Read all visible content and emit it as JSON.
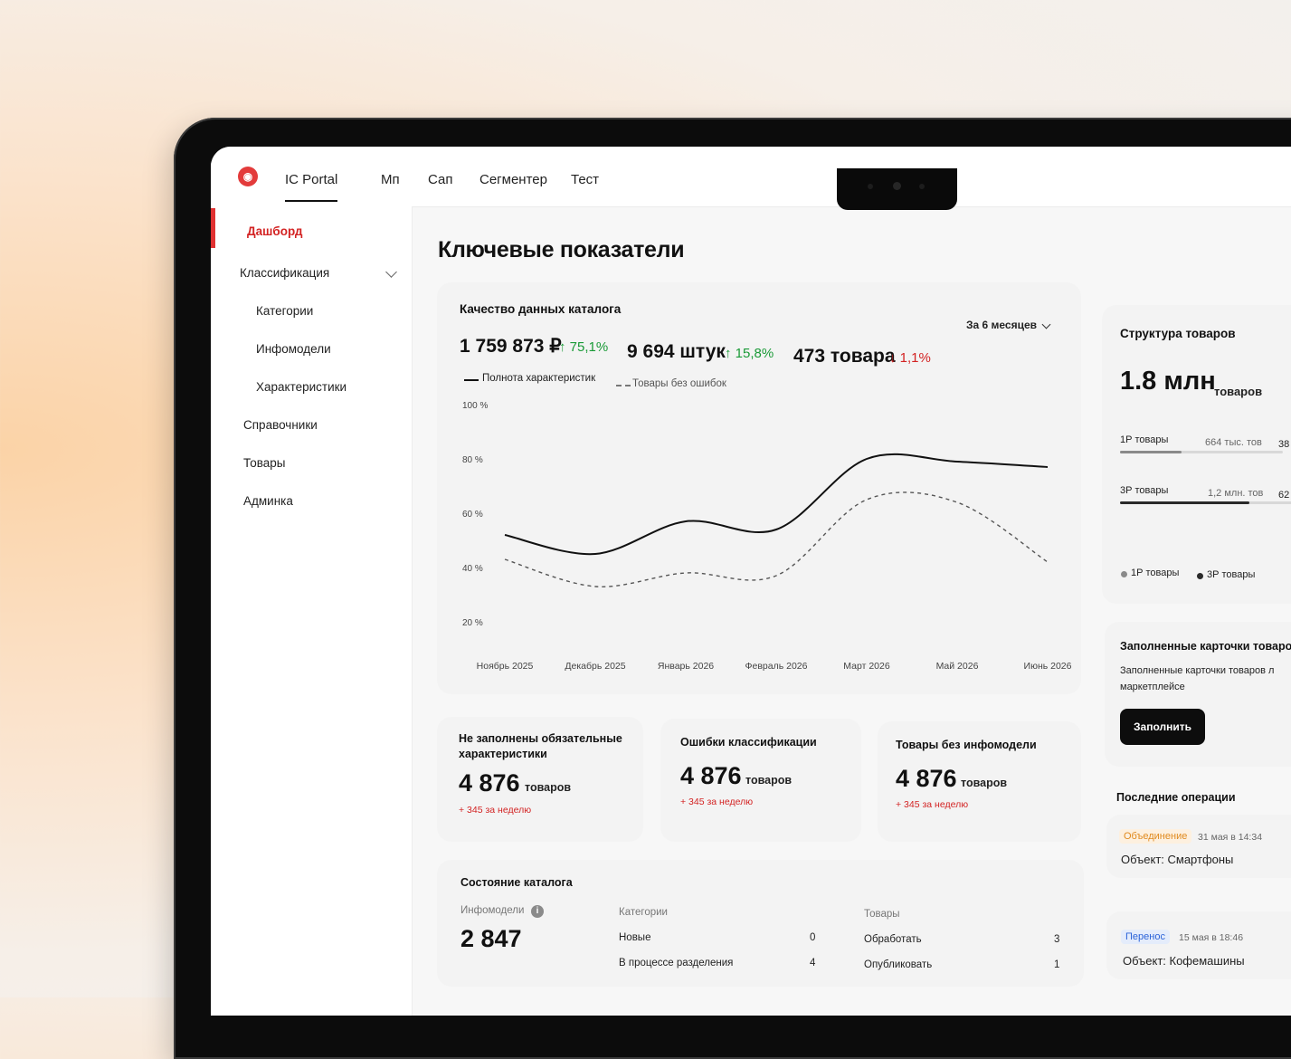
{
  "nav": {
    "tabs": [
      "IC Portal",
      "Мп",
      "Сап",
      "Сегментер",
      "Тест"
    ],
    "active_tab": "IC Portal"
  },
  "sidebar": {
    "items": [
      {
        "label": "Дашборд",
        "active": true
      },
      {
        "label": "Классификация",
        "expanded": true
      },
      {
        "label": "Категории"
      },
      {
        "label": "Инфомодели"
      },
      {
        "label": "Характеристики"
      },
      {
        "label": "Справочники"
      },
      {
        "label": "Товары"
      },
      {
        "label": "Админка"
      }
    ]
  },
  "main": {
    "title": "Ключевые показатели",
    "quality": {
      "title": "Качество данных каталога",
      "period": "За 6 месяцев",
      "metrics": [
        {
          "value": "1 759 873 ₽",
          "delta": "↑ 75,1%",
          "trend": "up"
        },
        {
          "value": "9 694 штук",
          "delta": "↑ 15,8%",
          "trend": "up"
        },
        {
          "value": "473 товара",
          "delta": "↓ 1,1%",
          "trend": "down"
        }
      ],
      "legend": [
        "Полнота характеристик",
        "Товары без ошибок"
      ]
    },
    "kpis": [
      {
        "title": "Не заполнены обязательные характеристики",
        "value": "4 876",
        "unit": "товаров",
        "delta": "+ 345 за неделю"
      },
      {
        "title": "Ошибки классификации",
        "value": "4 876",
        "unit": "товаров",
        "delta": "+ 345 за неделю"
      },
      {
        "title": "Товары без инфомодели",
        "value": "4 876",
        "unit": "товаров",
        "delta": "+ 345 за неделю"
      }
    ],
    "catalog_state": {
      "title": "Состояние каталога",
      "infomodels_label": "Инфомодели",
      "infomodels_value": "2 847",
      "categories_label": "Категории",
      "categories": [
        {
          "label": "Новые",
          "value": "0"
        },
        {
          "label": "В процессе разделения",
          "value": "4"
        }
      ],
      "goods_label": "Товары",
      "goods": [
        {
          "label": "Обработать",
          "value": "3"
        },
        {
          "label": "Опубликовать",
          "value": "1"
        }
      ]
    }
  },
  "right": {
    "structure": {
      "title": "Структура товаров",
      "total": "1.8 млн",
      "total_unit": "товаров",
      "rows": [
        {
          "label": "1Р товары",
          "amount": "664 тыс. тов",
          "percent_text": "38",
          "share": 0.38
        },
        {
          "label": "3Р товары",
          "amount": "1,2 млн. тов",
          "percent_text": "62",
          "share": 0.62
        }
      ],
      "legend": [
        {
          "label": "1Р товары",
          "color": "#8a8a8a"
        },
        {
          "label": "3Р товары",
          "color": "#2a2a2a"
        }
      ]
    },
    "filled": {
      "title": "Заполненные карточки товаро",
      "text_line1": "Заполненные карточки товаров л",
      "text_line2": "маркетплейсе",
      "button": "Заполнить"
    },
    "operations": {
      "title": "Последние операции",
      "items": [
        {
          "badge": "Объединение",
          "badge_color": "#e08a1e",
          "badge_bg": "#fdf0df",
          "date": "31 мая в 14:34",
          "object": "Объект: Смартфоны"
        },
        {
          "badge": "Перенос",
          "badge_color": "#2b63d9",
          "badge_bg": "#e4ecfb",
          "date": "15 мая в 18:46",
          "object": "Объект: Кофемашины"
        }
      ]
    }
  },
  "chart_data": {
    "type": "line",
    "x": [
      "Ноябрь 2025",
      "Декабрь 2025",
      "Январь 2026",
      "Февраль 2026",
      "Март 2026",
      "Май 2026",
      "Июнь 2026"
    ],
    "y_ticks": [
      "100 %",
      "80 %",
      "60 %",
      "40 %",
      "20 %"
    ],
    "ylim": [
      20,
      100
    ],
    "series": [
      {
        "name": "Полнота характеристик",
        "style": "solid",
        "values": [
          52,
          45,
          57,
          54,
          80,
          79,
          77
        ]
      },
      {
        "name": "Товары без ошибок",
        "style": "dashed",
        "values": [
          43,
          33,
          38,
          37,
          65,
          64,
          42
        ]
      }
    ]
  }
}
